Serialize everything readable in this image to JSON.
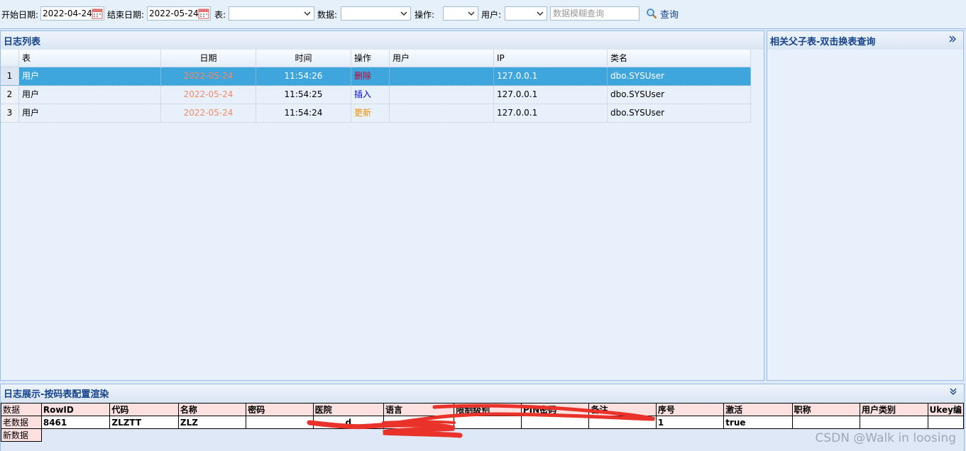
{
  "toolbar": {
    "start_date_label": "开始日期:",
    "start_date_value": "2022-04-24",
    "end_date_label": "结束日期:",
    "end_date_value": "2022-05-24",
    "table_label": "表:",
    "data_label": "数据:",
    "operation_label": "操作:",
    "user_label": "用户:",
    "search_placeholder": "数据模糊查询",
    "search_button": "查询"
  },
  "log_panel": {
    "title": "日志列表",
    "columns": [
      "表",
      "日期",
      "时间",
      "操作",
      "用户",
      "IP",
      "类名"
    ],
    "rows": [
      {
        "num": "1",
        "table": "用户",
        "date": "2022-05-24",
        "time": "11:54:26",
        "operation": "删除",
        "user": "",
        "ip": "127.0.0.1",
        "class": "dbo.SYSUser"
      },
      {
        "num": "2",
        "table": "用户",
        "date": "2022-05-24",
        "time": "11:54:25",
        "operation": "插入",
        "user": "",
        "ip": "127.0.0.1",
        "class": "dbo.SYSUser"
      },
      {
        "num": "3",
        "table": "用户",
        "date": "2022-05-24",
        "time": "11:54:24",
        "operation": "更新",
        "user": "",
        "ip": "127.0.0.1",
        "class": "dbo.SYSUser"
      }
    ]
  },
  "related_panel": {
    "title": "相关父子表-双击换表查询"
  },
  "detail_panel": {
    "title": "日志展示-按码表配置渲染",
    "headers": [
      "数据",
      "RowID",
      "代码",
      "名称",
      "密码",
      "医院",
      "语言",
      "限制级别",
      "PIN密码",
      "备注",
      "序号",
      "激活",
      "职称",
      "用户类别",
      "Ukey编"
    ],
    "old_row_label": "老数据",
    "old_row": [
      "8461",
      "ZLZTT",
      "ZLZ",
      "",
      "d",
      "",
      "",
      "",
      "",
      "1",
      "true",
      "",
      "",
      ""
    ],
    "new_row_label": "新数据"
  },
  "watermark": "CSDN @Walk in loosing",
  "colors": {
    "accent": "#15428b",
    "selected_row": "#3ea6dc",
    "date_text": "#f28a64",
    "delete": "#c00030",
    "insert": "#0000e0",
    "update": "#f09000",
    "header_pink": "#fde0e0"
  }
}
